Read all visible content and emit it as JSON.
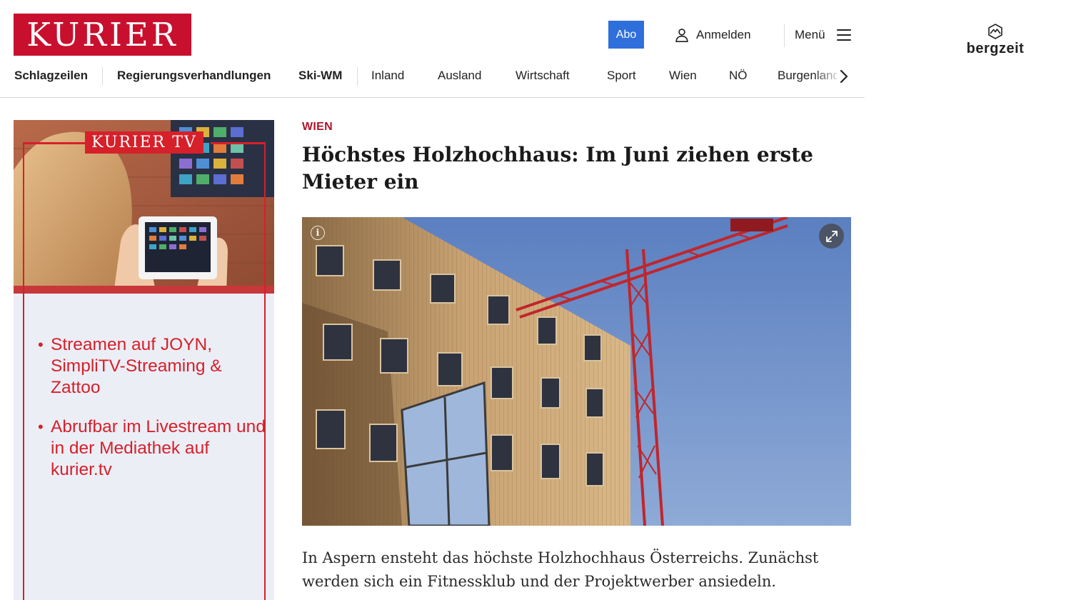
{
  "brand": {
    "logo_text": "KURIER",
    "color": "#c8102e"
  },
  "header": {
    "abo_label": "Abo",
    "login_label": "Anmelden",
    "menu_label": "Menü",
    "login_icon": "user-icon",
    "menu_icon": "hamburger-icon"
  },
  "nav": {
    "items": [
      {
        "label": "Schlagzeilen"
      },
      {
        "label": "Regierungsverhandlungen"
      },
      {
        "label": "Ski-WM"
      },
      {
        "label": "Inland"
      },
      {
        "label": "Ausland"
      },
      {
        "label": "Wirtschaft"
      },
      {
        "label": "Sport"
      },
      {
        "label": "Wien"
      },
      {
        "label": "NÖ"
      },
      {
        "label": "Burgenland"
      }
    ],
    "next_icon": "chevron-right-icon"
  },
  "partner": {
    "name": "bergzeit"
  },
  "ad": {
    "badge": "KURIER TV",
    "bullets": [
      "Streamen auf JOYN, SimpliTV-Streaming & Zattoo",
      "Abrufbar im Livestream und in der Mediathek auf kurier.tv"
    ],
    "accent_color": "#d6202a"
  },
  "article": {
    "category": "WIEN",
    "headline": "Höchstes Holzhochhaus: Im Juni ziehen erste Mieter ein",
    "lead": "In Aspern ensteht das höchste Holzhochhaus Österreichs. Zunächst werden sich ein Fitnessklub und der Projektwerber ansiedeln.",
    "image_icons": [
      "info-icon",
      "expand-icon"
    ]
  }
}
